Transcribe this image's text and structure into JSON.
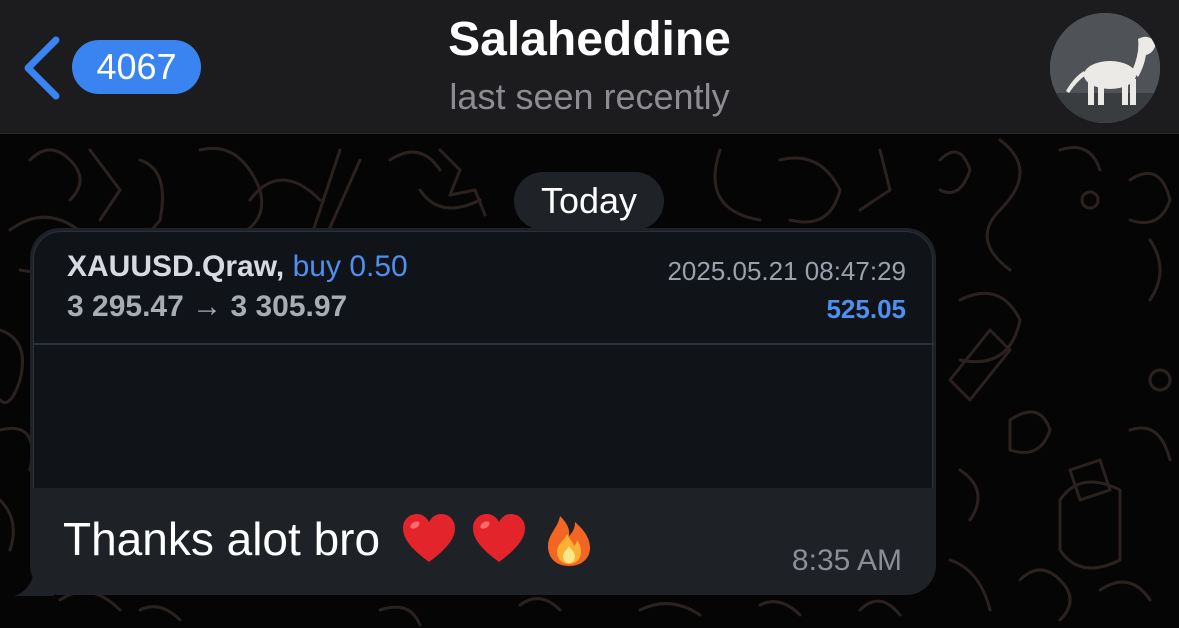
{
  "header": {
    "back_badge_count": "4067",
    "contact_name": "Salaheddine",
    "status": "last seen recently"
  },
  "chat": {
    "date_label": "Today",
    "message": {
      "trade": {
        "symbol": "XAUUSD.Qraw,",
        "direction": "buy 0.50",
        "prices": "3 295.47 → 3 305.97",
        "datetime": "2025.05.21 08:47:29",
        "profit": "525.05"
      },
      "text": "Thanks alot bro",
      "emojis": [
        "red-heart-emoji",
        "red-heart-emoji",
        "fire-emoji"
      ],
      "time": "8:35 AM"
    }
  },
  "colors": {
    "header_bg": "#1c1b1d",
    "badge_blue": "#3a84f2",
    "bubble_bg": "#1e2227",
    "card_bg": "#101419",
    "accent_blue": "#4e8ff0"
  }
}
